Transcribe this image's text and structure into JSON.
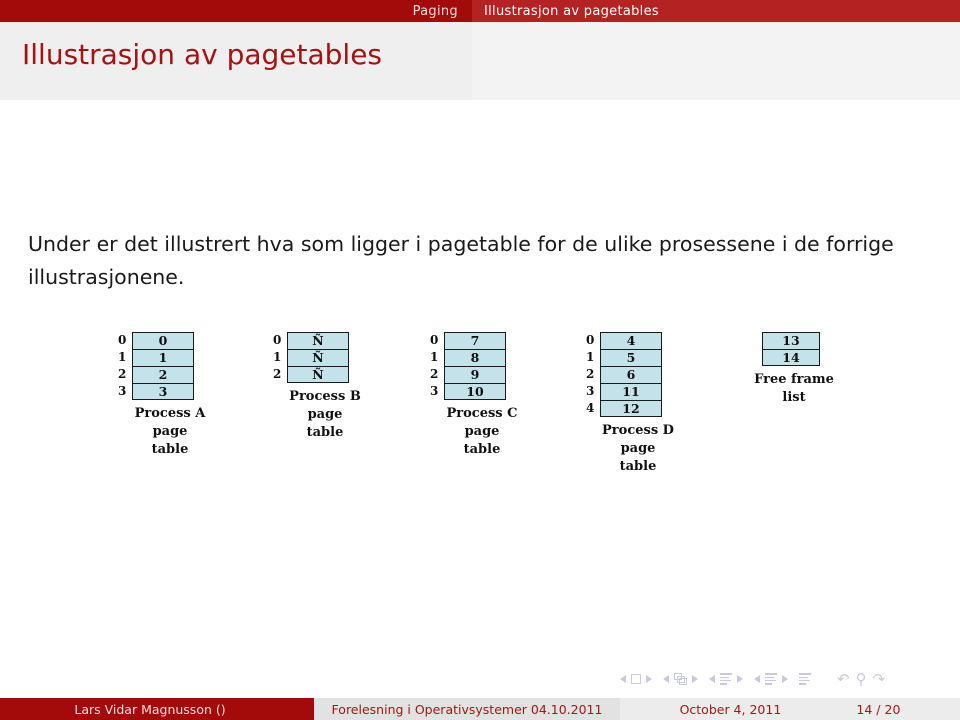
{
  "header": {
    "section_label": "Paging",
    "subsection_label": "Illustrasjon av pagetables"
  },
  "slide": {
    "title": "Illustrasjon av pagetables",
    "body_text": "Under er det illustrert hva som ligger i pagetable for de ulike prosessene i de forrige illustrasjonene."
  },
  "diagram": {
    "tables": [
      {
        "caption_line1": "Process A",
        "caption_line2": "page table",
        "indices": [
          "0",
          "1",
          "2",
          "3"
        ],
        "values": [
          "0",
          "1",
          "2",
          "3"
        ],
        "has_index_column": true
      },
      {
        "caption_line1": "Process B",
        "caption_line2": "page table",
        "indices": [
          "0",
          "1",
          "2"
        ],
        "values": [
          "Ñ",
          "Ñ",
          "Ñ"
        ],
        "has_index_column": true
      },
      {
        "caption_line1": "Process C",
        "caption_line2": "page table",
        "indices": [
          "0",
          "1",
          "2",
          "3"
        ],
        "values": [
          "7",
          "8",
          "9",
          "10"
        ],
        "has_index_column": true
      },
      {
        "caption_line1": "Process D",
        "caption_line2": "page table",
        "indices": [
          "0",
          "1",
          "2",
          "3",
          "4"
        ],
        "values": [
          "4",
          "5",
          "6",
          "11",
          "12"
        ],
        "has_index_column": true
      },
      {
        "caption_line1": "Free frame",
        "caption_line2": "list",
        "indices": [],
        "values": [
          "13",
          "14"
        ],
        "has_index_column": false
      }
    ],
    "cell_color": "#c3e2ea",
    "border_color": "#1a1a1a"
  },
  "navbar": {
    "back_symbol": "↶",
    "search_symbol": "⚲",
    "forward_symbol": "↷"
  },
  "footer": {
    "author": "Lars Vidar Magnusson ()",
    "lecture": "Forelesning i Operativsystemer 04.10.2011",
    "date": "October 4, 2011",
    "page": "14 / 20"
  },
  "colors": {
    "brand_dark_red": "#a30a0a",
    "brand_light_red": "#b52222",
    "title_red": "#a61212",
    "table_blue": "#c3e2ea"
  }
}
